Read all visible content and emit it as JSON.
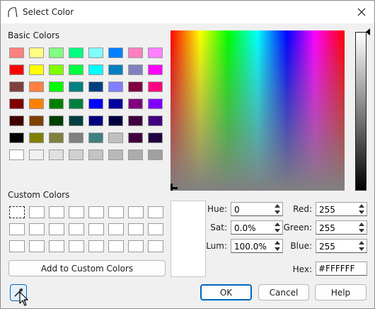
{
  "window": {
    "title": "Select Color"
  },
  "basic_colors": {
    "label": "Basic Colors",
    "rows": [
      [
        "#ff8080",
        "#ffff80",
        "#80ff80",
        "#00ff80",
        "#80ffff",
        "#0080ff",
        "#ff80c0",
        "#ff80ff"
      ],
      [
        "#ff0000",
        "#ffff00",
        "#80ff00",
        "#00ff40",
        "#00ffff",
        "#0080c0",
        "#8080c0",
        "#ff00ff"
      ],
      [
        "#804040",
        "#ff8040",
        "#00ff00",
        "#008080",
        "#004080",
        "#8080ff",
        "#800040",
        "#ff0080"
      ],
      [
        "#800000",
        "#ff8000",
        "#008000",
        "#008040",
        "#0000ff",
        "#0000a0",
        "#800080",
        "#8000ff"
      ],
      [
        "#400000",
        "#804000",
        "#004000",
        "#004040",
        "#000080",
        "#000040",
        "#400040",
        "#400080"
      ],
      [
        "#000000",
        "#808000",
        "#808040",
        "#808080",
        "#408080",
        "#c0c0c0",
        "#400040",
        "#200040"
      ],
      [
        "#ffffff",
        "#f0f0f0",
        "#e0e0e0",
        "#d0d0d0",
        "#c4c4c4",
        "#b8b8b8",
        "#acacac",
        "#a0a0a0"
      ]
    ]
  },
  "custom_colors": {
    "label": "Custom Colors",
    "add_label": "Add to Custom Colors"
  },
  "fields": {
    "hue": {
      "label": "Hue:",
      "value": "0"
    },
    "sat": {
      "label": "Sat:",
      "value": "0.0%"
    },
    "lum": {
      "label": "Lum:",
      "value": "100.0%"
    },
    "red": {
      "label": "Red:",
      "value": "255"
    },
    "green": {
      "label": "Green:",
      "value": "255"
    },
    "blue": {
      "label": "Blue:",
      "value": "255"
    },
    "hex": {
      "label": "Hex:",
      "value": "#FFFFFF"
    }
  },
  "current_color": "#FFFFFF",
  "buttons": {
    "ok": "OK",
    "cancel": "Cancel",
    "help": "Help"
  },
  "icons": {
    "app": "arc-icon",
    "close": "close-icon",
    "eyedropper": "eyedropper-icon"
  },
  "colors": {
    "accent": "#0067c0"
  }
}
